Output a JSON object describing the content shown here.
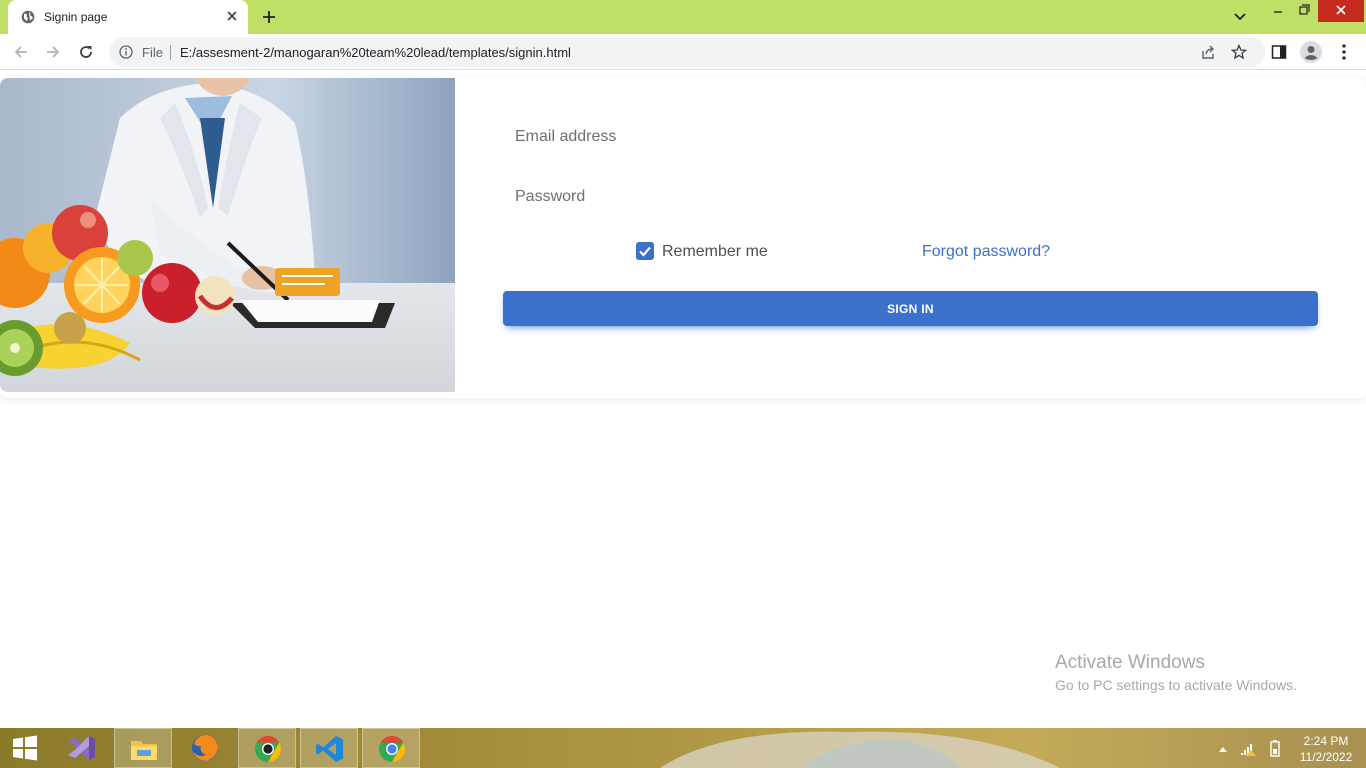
{
  "browser": {
    "tab_title": "Signin page",
    "scheme_label": "File",
    "url": "E:/assesment-2/manogaran%20team%20lead/templates/signin.html",
    "icons": [
      "globe-icon",
      "close-icon",
      "plus-icon",
      "back-icon",
      "forward-icon",
      "reload-icon",
      "info-icon",
      "share-icon",
      "star-icon",
      "side-panel-icon",
      "profile-icon",
      "menu-icon"
    ]
  },
  "form": {
    "email_placeholder": "Email address",
    "password_placeholder": "Password",
    "remember_label": "Remember me",
    "remember_checked": true,
    "forgot_label": "Forgot password?",
    "signin_label": "SIGN IN",
    "accent_color": "#3b71ca"
  },
  "watermark": {
    "heading": "Activate Windows",
    "subtext": "Go to PC settings to activate Windows."
  },
  "taskbar": {
    "time": "2:24 PM",
    "date": "11/2/2022",
    "apps": [
      "visual-studio-icon",
      "file-explorer-icon",
      "firefox-icon",
      "chrome-canary-icon",
      "vscode-icon",
      "chrome-icon"
    ]
  }
}
